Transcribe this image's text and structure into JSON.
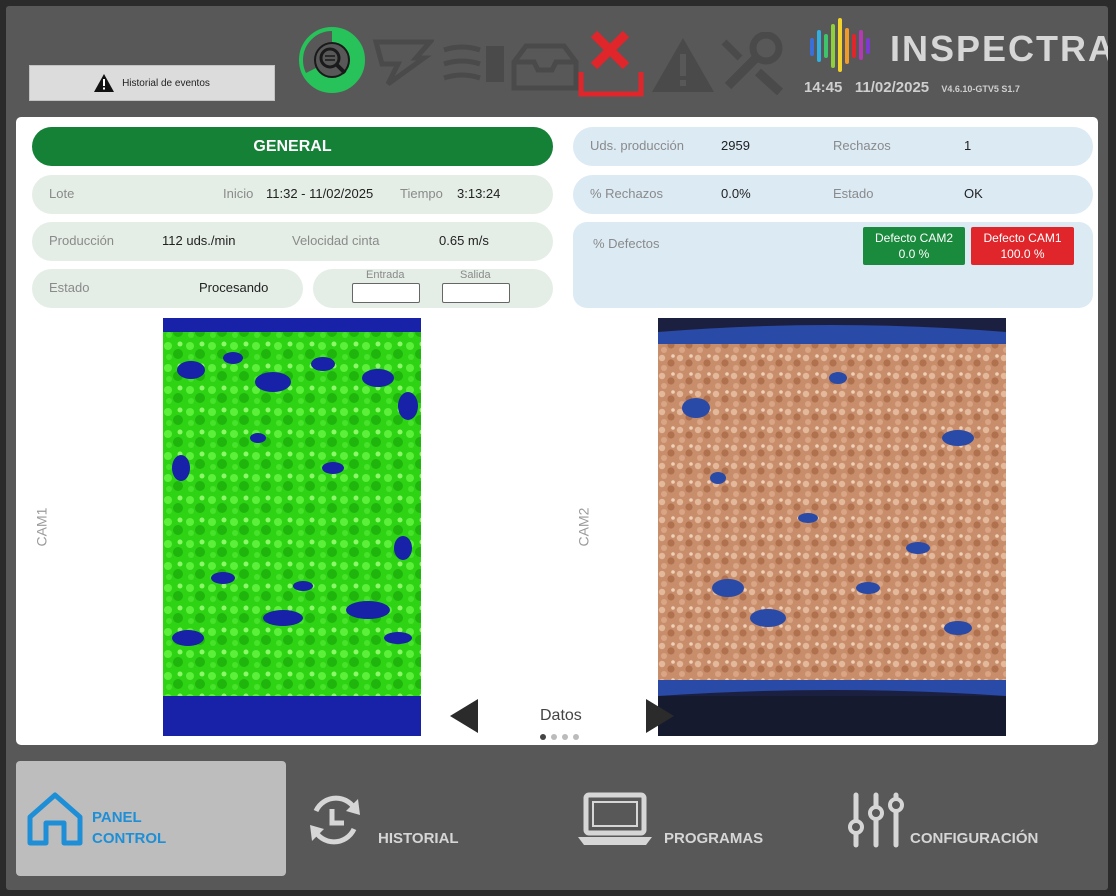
{
  "header": {
    "events_button": "Historial de eventos",
    "brand": "INSPECTRA",
    "time": "14:45",
    "date": "11/02/2025",
    "version": "V4.6.10-GTV5 S1.7"
  },
  "left_panel": {
    "title": "GENERAL",
    "lote_label": "Lote",
    "inicio_label": "Inicio",
    "inicio_value": "11:32 - 11/02/2025",
    "tiempo_label": "Tiempo",
    "tiempo_value": "3:13:24",
    "produccion_label": "Producción",
    "produccion_value": "112 uds./min",
    "velocidad_label": "Velocidad cinta",
    "velocidad_value": "0.65 m/s",
    "estado_label": "Estado",
    "estado_value": "Procesando",
    "entrada_label": "Entrada",
    "salida_label": "Salida",
    "entrada_value": "",
    "salida_value": ""
  },
  "right_panel": {
    "uds_label": "Uds. producción",
    "uds_value": "2959",
    "rechazos_label": "Rechazos",
    "rechazos_value": "1",
    "pct_rechazos_label": "% Rechazos",
    "pct_rechazos_value": "0.0%",
    "estado_label": "Estado",
    "estado_value": "OK",
    "defectos_label": "% Defectos",
    "badges": [
      {
        "name": "Defecto CAM2",
        "value": "0.0 %",
        "color": "#1a8a3c"
      },
      {
        "name": "Defecto CAM1",
        "value": "100.0 %",
        "color": "#e0262b"
      }
    ]
  },
  "cameras": {
    "cam1_label": "CAM1",
    "cam2_label": "CAM2"
  },
  "pager": {
    "label": "Datos",
    "pages": 4,
    "current": 1
  },
  "bottom_nav": {
    "panel": [
      "PANEL",
      "CONTROL"
    ],
    "historial": "HISTORIAL",
    "programas": "PROGRAMAS",
    "configuracion": "CONFIGURACIÓN"
  },
  "colors": {
    "accent_green": "#148137",
    "active_blue": "#1e8fd6",
    "error_red": "#e0262b"
  },
  "icons": [
    "warning-icon",
    "inspection-mode-icon",
    "tool-icon",
    "air-icon",
    "tray-icon",
    "reject-x-icon",
    "alarm-icon",
    "wrench-icon",
    "home-icon",
    "history-icon",
    "laptop-icon",
    "sliders-icon"
  ]
}
